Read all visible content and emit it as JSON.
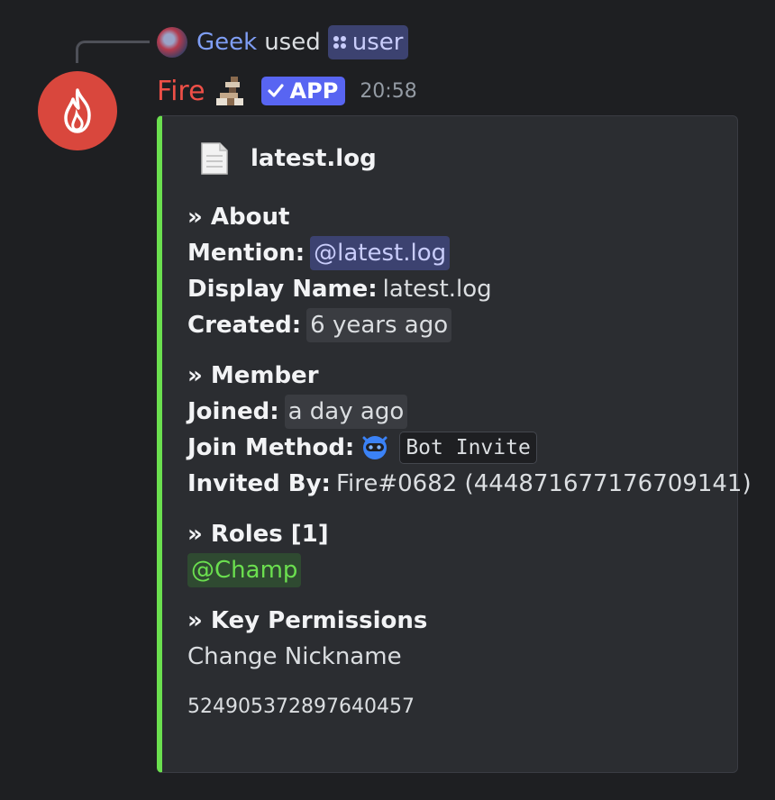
{
  "reply": {
    "user": "Geek",
    "action": "used",
    "command": "user"
  },
  "message": {
    "author": "Fire",
    "badge": "APP",
    "timestamp": "20:58"
  },
  "embed": {
    "accent_color": "#6bdf4f",
    "author_icon": "file-icon",
    "author_name": "latest.log",
    "about": {
      "title": "» About",
      "mention_label": "Mention:",
      "mention_value": "@latest.log",
      "display_name_label": "Display Name:",
      "display_name_value": "latest.log",
      "created_label": "Created:",
      "created_value": "6 years ago"
    },
    "member": {
      "title": "» Member",
      "joined_label": "Joined:",
      "joined_value": "a day ago",
      "join_method_label": "Join Method:",
      "join_method_value": "Bot Invite",
      "invited_by_label": "Invited By:",
      "invited_by_value": "Fire#0682 (444871677176709141)"
    },
    "roles": {
      "title": "» Roles [1]",
      "items": [
        "@Champ"
      ]
    },
    "permissions": {
      "title": "» Key Permissions",
      "value": "Change Nickname"
    },
    "footer": "524905372897640457"
  },
  "colors": {
    "background": "#1e1f22",
    "embed_bg": "#2b2d31",
    "author": "#ee4f47",
    "app_badge": "#5865f2",
    "mention_bg": "#3c4270",
    "role": "#6bdf4f"
  }
}
